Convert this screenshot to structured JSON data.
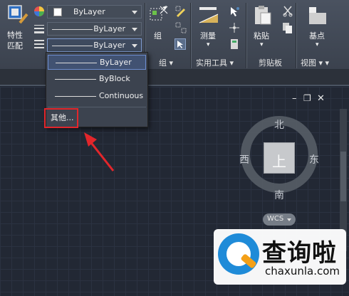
{
  "ribbon": {
    "match_properties_label": "特性\n匹配",
    "color_combo": "ByLayer",
    "linetype_combo": "ByLayer",
    "lineweight_combo": "ByLayer",
    "group_button_label": "组",
    "measure_button_label": "测量",
    "paste_button_label": "粘贴",
    "base_button_label": "基点",
    "panels": {
      "group": "组",
      "utilities": "实用工具",
      "clipboard": "剪贴板",
      "view": "视图"
    }
  },
  "linetype_dropdown": {
    "items": [
      {
        "label": "ByLayer",
        "selected": true
      },
      {
        "label": "ByBlock",
        "selected": false
      },
      {
        "label": "Continuous",
        "selected": false
      }
    ],
    "other_label": "其他..."
  },
  "viewcube": {
    "north": "北",
    "south": "南",
    "west": "西",
    "east": "东",
    "face": "上",
    "wcs_label": "WCS"
  },
  "window_controls": {
    "minimize": "–",
    "restore": "❐",
    "close": "✕"
  },
  "watermark": {
    "chinese": "查询啦",
    "domain": "chaxunla.com"
  },
  "colors": {
    "highlight_box": "#e2262b",
    "selection": "#415272"
  }
}
